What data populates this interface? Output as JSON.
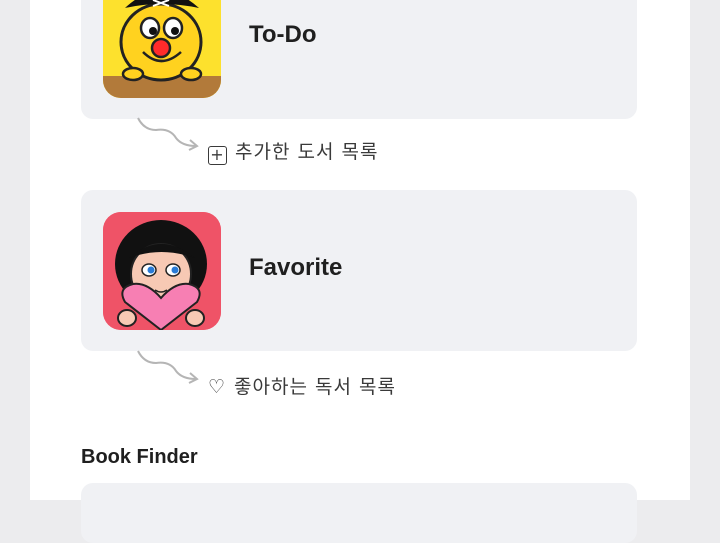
{
  "lists": [
    {
      "title": "To-Do",
      "thumbnail_icon": "pirate-character-icon",
      "caption_icon": "plus-box-icon",
      "caption_glyph": "+",
      "caption": "추가한 도서 목록"
    },
    {
      "title": "Favorite",
      "thumbnail_icon": "girl-heart-character-icon",
      "caption_icon": "heart-outline-icon",
      "caption_glyph": "♡",
      "caption": "좋아하는 독서 목록"
    }
  ],
  "book_finder": {
    "title": "Book Finder"
  },
  "colors": {
    "todo_thumb": "#fde12d",
    "fav_thumb": "#ef5367",
    "card_bg": "#f0f1f4",
    "page_bg": "#ffffff"
  }
}
